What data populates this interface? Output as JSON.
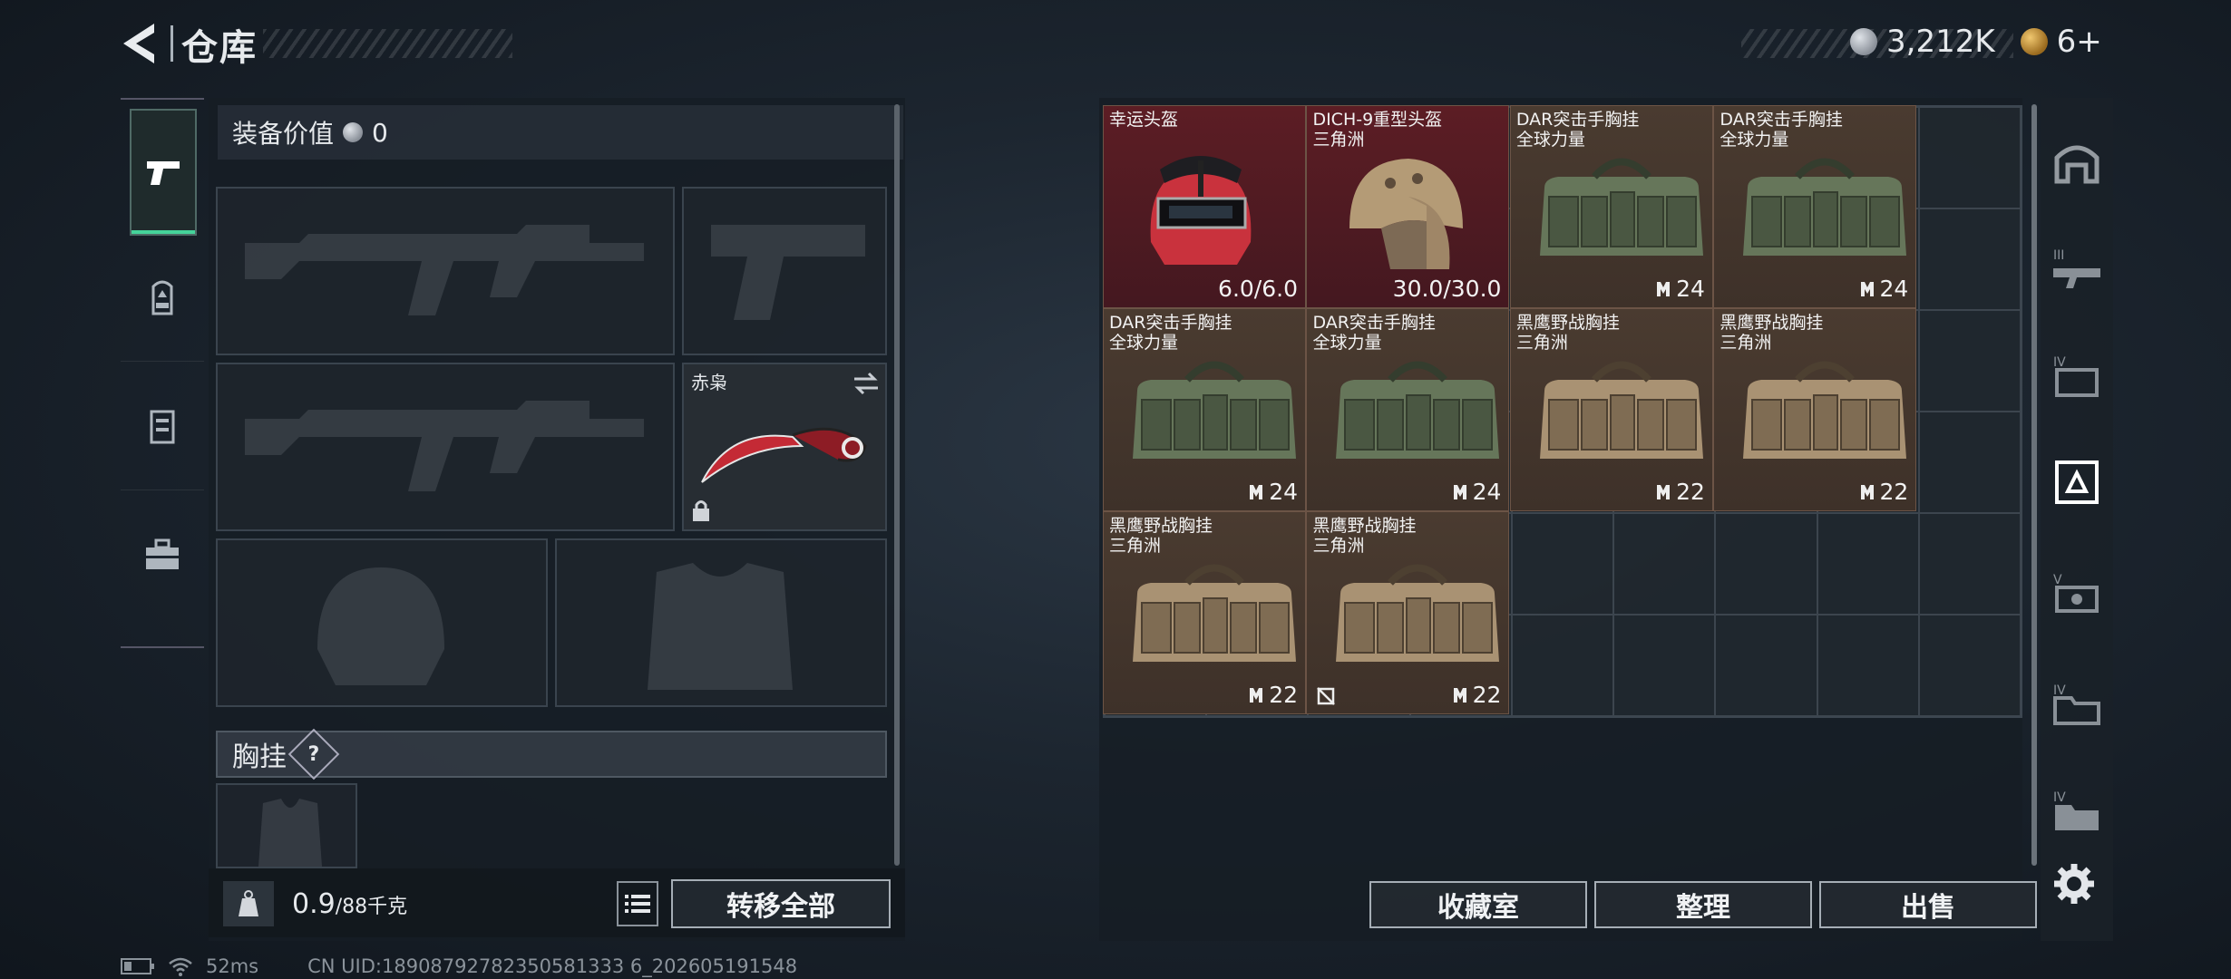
{
  "header": {
    "title": "仓库",
    "currency": "3,212K",
    "level": "6+"
  },
  "equip": {
    "value_label": "装备价值",
    "value": "0",
    "knife_name": "赤枭",
    "chest_label": "胸挂",
    "help": "?",
    "weight_current": "0.9",
    "weight_max": "/88千克",
    "transfer_all": "转移全部"
  },
  "items": [
    {
      "name": "幸运头盔",
      "sub": "",
      "value": "6.0/6.0",
      "rarity": "red",
      "kind": "helmet-red"
    },
    {
      "name": "DICH-9重型头盔",
      "sub": "三角洲",
      "value": "30.0/30.0",
      "rarity": "red",
      "kind": "helmet-tan"
    },
    {
      "name": "DAR突击手胸挂",
      "sub": "全球力量",
      "value": "24",
      "rarity": "brown",
      "kind": "vest-green"
    },
    {
      "name": "DAR突击手胸挂",
      "sub": "全球力量",
      "value": "24",
      "rarity": "brown",
      "kind": "vest-green"
    },
    {
      "name": "DAR突击手胸挂",
      "sub": "全球力量",
      "value": "24",
      "rarity": "brown",
      "kind": "vest-green"
    },
    {
      "name": "DAR突击手胸挂",
      "sub": "全球力量",
      "value": "24",
      "rarity": "brown",
      "kind": "vest-green"
    },
    {
      "name": "黑鹰野战胸挂",
      "sub": "三角洲",
      "value": "22",
      "rarity": "brown",
      "kind": "vest-tan"
    },
    {
      "name": "黑鹰野战胸挂",
      "sub": "三角洲",
      "value": "22",
      "rarity": "brown",
      "kind": "vest-tan"
    },
    {
      "name": "黑鹰野战胸挂",
      "sub": "三角洲",
      "value": "22",
      "rarity": "brown",
      "kind": "vest-tan"
    },
    {
      "name": "黑鹰野战胸挂",
      "sub": "三角洲",
      "value": "22",
      "rarity": "brown",
      "kind": "vest-tan"
    }
  ],
  "buttons": {
    "collection": "收藏室",
    "organize": "整理",
    "sell": "出售"
  },
  "status": {
    "ping": "52ms",
    "uid": "CN UID:18908792782350581333 6_202605191548"
  },
  "icons": [
    "back-arrow-icon",
    "pistol-icon",
    "backpack-icon",
    "locker-icon",
    "toolbox-icon",
    "gear-icon"
  ]
}
